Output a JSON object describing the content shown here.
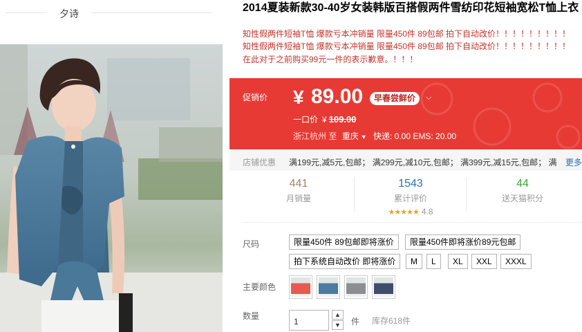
{
  "shop": {
    "name": "夕诗"
  },
  "product": {
    "title": "2014夏装新款30-40岁女装韩版百搭假两件雪纺印花短袖宽松T恤上衣",
    "subtitle_1": "知性假两件短袖T恤 爆款亏本冲销量 限量450件 89包邮 拍下自动改价！！！！！！！！！",
    "subtitle_2": "知性假两件短袖T恤 爆款亏本冲销量 限量450件 89包邮 拍下自动改价！！！！！！！！！",
    "subtitle_3": "在此对于之前购买99元一件的表示歉意。！！！"
  },
  "price": {
    "promo_label": "促销价",
    "currency": "¥",
    "value": "89.00",
    "badge": "早春尝鲜价",
    "one_price_label": "一口价",
    "one_price_currency": "¥",
    "one_price": "109.00"
  },
  "shipping": {
    "from": "浙江杭州",
    "to_label": "至",
    "to_city": "重庆",
    "info": "快递: 0.00 EMS: 20.00"
  },
  "shop_deals": {
    "label": "店铺优惠",
    "text": "满199元,减5元,包邮； 满299元,减10元,包邮； 满399元,减15元,包邮； 满",
    "more": "更多"
  },
  "stats": {
    "monthly_sales": "441",
    "monthly_sales_label": "月销量",
    "reviews": "1543",
    "reviews_label": "累计评价",
    "stars": "★★★★★",
    "rating": "4.8",
    "points": "44",
    "points_label": "送天猫积分"
  },
  "options": {
    "size_label": "尺码",
    "sizes": [
      "限量450件 89包邮即将涨价",
      "限量450件即将涨价89元包邮",
      "拍下系统自动改价 即将涨价",
      "M",
      "L",
      "XL",
      "XXL",
      "XXXL"
    ],
    "color_label": "主要颜色",
    "colors": [
      {
        "name": "red",
        "color": "#e65a4f"
      },
      {
        "name": "blue",
        "color": "#4a7aa0"
      },
      {
        "name": "grey",
        "color": "#8c8f92"
      },
      {
        "name": "navy",
        "color": "#3e4d6a"
      }
    ],
    "quantity_label": "数量",
    "quantity": "1",
    "unit": "件",
    "stock": "库存618件"
  }
}
